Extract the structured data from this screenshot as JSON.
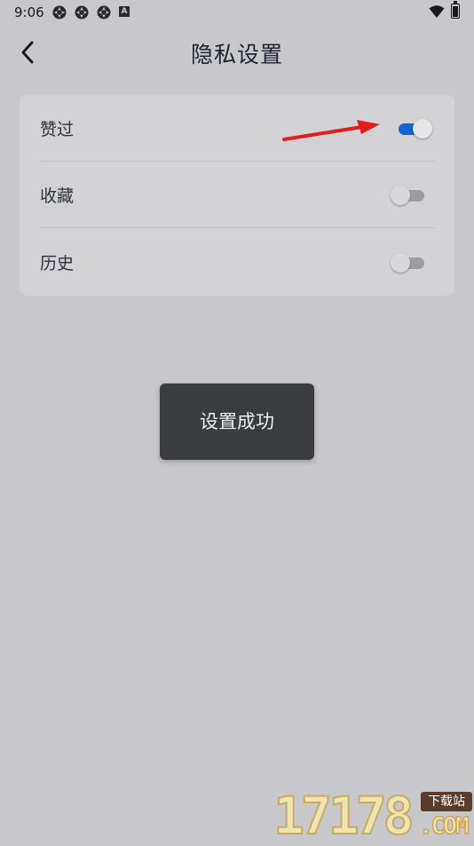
{
  "status_bar": {
    "time": "9:06",
    "notification_icons": [
      "settings-gear-icon",
      "settings-gear-icon",
      "settings-gear-icon"
    ],
    "badge_letter": "A"
  },
  "header": {
    "title": "隐私设置",
    "back_icon": "chevron-left-icon"
  },
  "settings": {
    "items": [
      {
        "label": "赞过",
        "enabled": true
      },
      {
        "label": "收藏",
        "enabled": false
      },
      {
        "label": "历史",
        "enabled": false
      }
    ]
  },
  "toast": {
    "message": "设置成功"
  },
  "annotation": {
    "arrow_color": "#e01e1e"
  },
  "watermark": {
    "digits": "17178",
    "badge": "下载站",
    "domain": ".COM"
  },
  "colors": {
    "accent": "#1463d9",
    "background": "#c8c8ca",
    "toast_bg": "#3b3c3e"
  }
}
